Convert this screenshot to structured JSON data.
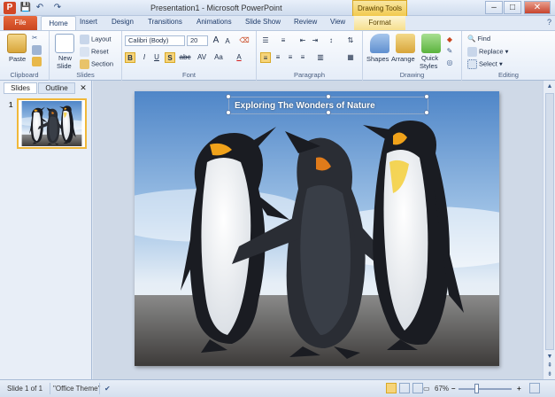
{
  "window": {
    "title": "Presentation1 - Microsoft PowerPoint",
    "contextual_group": "Drawing Tools",
    "minimize": "–",
    "maximize": "□",
    "close": "✕"
  },
  "qat": {
    "save": "💾",
    "undo": "↶",
    "redo": "↷"
  },
  "tabs": {
    "file": "File",
    "items": [
      "Home",
      "Insert",
      "Design",
      "Transitions",
      "Animations",
      "Slide Show",
      "Review",
      "View"
    ],
    "contextual": "Format",
    "help": "?"
  },
  "ribbon": {
    "clipboard": {
      "label": "Clipboard",
      "paste": "Paste"
    },
    "slides": {
      "label": "Slides",
      "new_slide_line1": "New",
      "new_slide_line2": "Slide",
      "layout": "Layout",
      "reset": "Reset",
      "section": "Section"
    },
    "font": {
      "label": "Font",
      "family": "Calibri (Body)",
      "size": "20",
      "bold": "B",
      "italic": "I",
      "underline": "U",
      "shadow": "S",
      "strike": "abc",
      "spacing": "AV",
      "case": "Aa",
      "color": "A",
      "grow": "A",
      "shrink": "A"
    },
    "paragraph": {
      "label": "Paragraph"
    },
    "drawing": {
      "label": "Drawing",
      "shapes": "Shapes",
      "arrange": "Arrange",
      "quick_styles_line1": "Quick",
      "quick_styles_line2": "Styles"
    },
    "editing": {
      "label": "Editing",
      "find": "Find",
      "replace": "Replace",
      "select": "Select"
    }
  },
  "left_pane": {
    "tab_slides": "Slides",
    "tab_outline": "Outline",
    "close": "✕",
    "thumb_number": "1"
  },
  "slide": {
    "title": "Exploring The Wonders of Nature"
  },
  "status": {
    "slide_info": "Slide 1 of 1",
    "theme": "\"Office Theme\"",
    "zoom": "67%",
    "zoom_minus": "–",
    "zoom_plus": "+"
  },
  "colors": {
    "file_tab": "#c9461f",
    "accent": "#2b4a7a",
    "contextual": "#f2c94e"
  }
}
